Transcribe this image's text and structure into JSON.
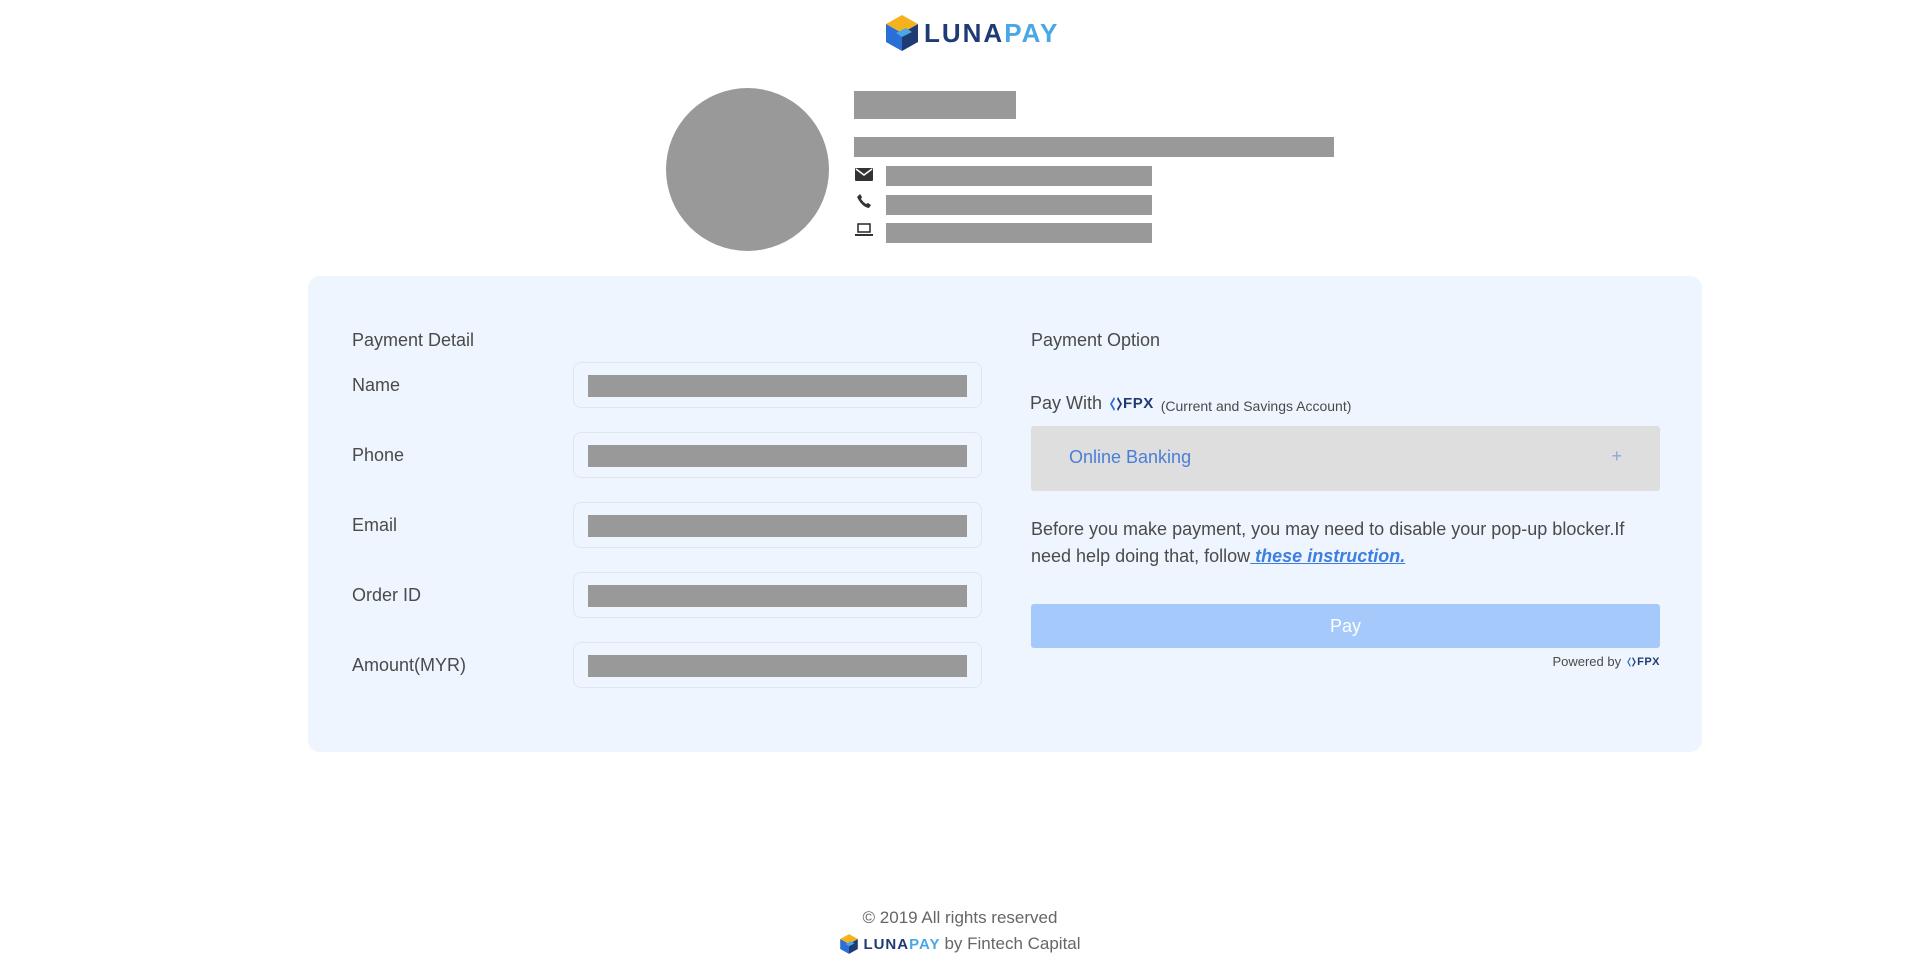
{
  "brand": {
    "name_part1": "LUNA",
    "name_part2": "PAY"
  },
  "colors": {
    "card_bg": "#eef5fe",
    "redacted": "#999999",
    "link": "#3d7ee0",
    "pay_button": "#a5c9fa",
    "bank_select_bg": "#dedede"
  },
  "icons": {
    "email": "envelope-icon",
    "phone": "phone-icon",
    "website": "laptop-icon"
  },
  "payment_detail": {
    "title": "Payment Detail",
    "fields": [
      {
        "label": "Name"
      },
      {
        "label": "Phone"
      },
      {
        "label": "Email"
      },
      {
        "label": "Order ID"
      },
      {
        "label": "Amount(MYR)"
      }
    ]
  },
  "payment_option": {
    "title": "Payment Option",
    "pay_with": "Pay With",
    "fpx_text": "FPX",
    "account_note": "(Current and Savings Account)",
    "bank_select": {
      "label": "Online Banking",
      "toggle": "+"
    },
    "notice_text": "Before you make payment, you may need to disable your pop-up blocker.If need help doing that, follow",
    "notice_link": " these instruction.",
    "pay_button": "Pay",
    "powered_by": "Powered by"
  },
  "footer": {
    "copyright": "© 2019 All rights reserved",
    "by_text": "by Fintech Capital"
  }
}
